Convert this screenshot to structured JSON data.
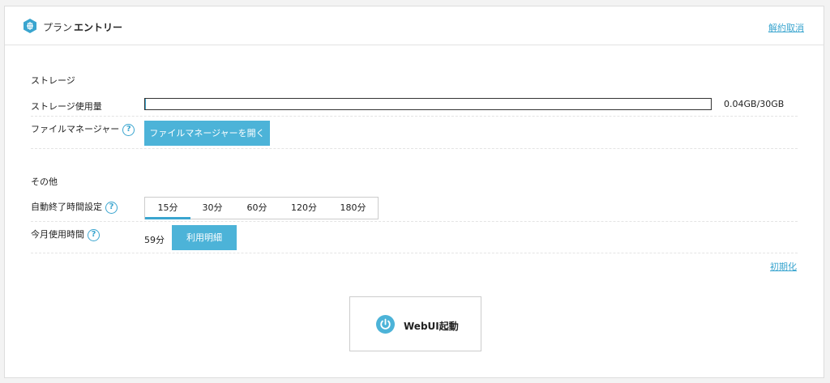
{
  "header": {
    "plan_label": "プラン",
    "plan_name": "エントリー",
    "cancel_link": "解約取消",
    "plan_icon": "brain-icon"
  },
  "storage_section": {
    "title": "ストレージ",
    "usage_label": "ストレージ使用量",
    "usage_text": "0.04GB/30GB",
    "usage_fraction": 0.0013,
    "file_manager_label": "ファイルマネージャー",
    "file_manager_button": "ファイルマネージャーを開く",
    "help_icon": "question-circle-icon",
    "external_icon": "external-link-icon"
  },
  "other_section": {
    "title": "その他",
    "auto_stop_label": "自動終了時間設定",
    "auto_stop_options": [
      "15分",
      "30分",
      "60分",
      "120分",
      "180分"
    ],
    "auto_stop_selected": "15分",
    "monthly_label": "今月使用時間",
    "monthly_value": "59分",
    "details_button": "利用明細",
    "reset_link": "初期化"
  },
  "launch": {
    "label": "WebUI起動",
    "icon": "power-icon"
  },
  "colors": {
    "accent": "#3aa5cf",
    "button": "#4cb3d8"
  }
}
